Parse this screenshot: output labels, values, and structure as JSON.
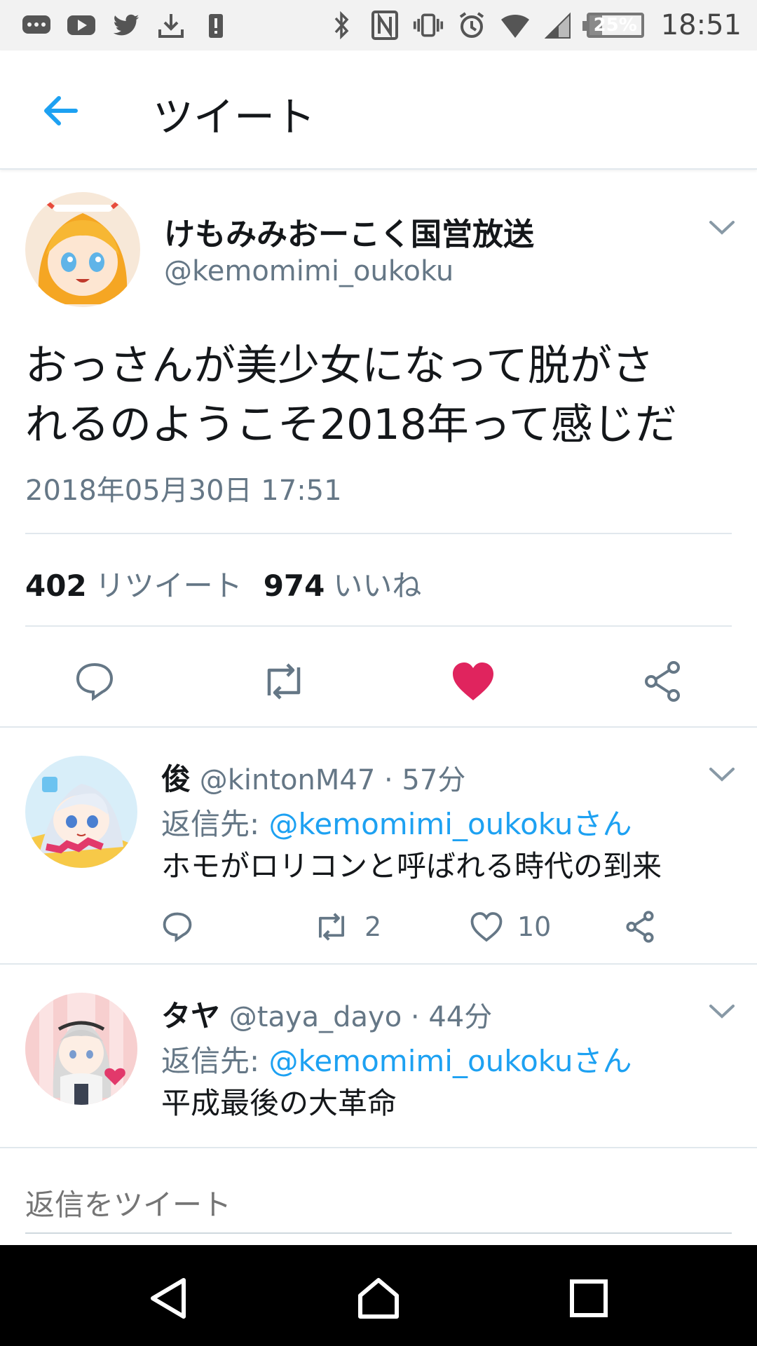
{
  "status_bar": {
    "icons": [
      "messages-icon",
      "youtube-icon",
      "twitter-icon",
      "download-icon",
      "alert-icon",
      "bluetooth-icon",
      "nfc-icon",
      "vibrate-icon",
      "alarm-icon",
      "wifi-icon",
      "signal-icon"
    ],
    "battery": "25%",
    "battery_level": 0.25,
    "time": "18:51"
  },
  "header": {
    "title": "ツイート"
  },
  "tweet": {
    "name": "けもみみおーこく国営放送",
    "handle": "@kemomimi_oukoku",
    "text_line1": "おっさんが美少女になって脱がさ",
    "text_line2": "れるのようこそ2018年って感じだ",
    "timestamp": "2018年05月30日 17:51",
    "retweets_count": "402",
    "retweets_label": "リツイート",
    "likes_count": "974",
    "likes_label": "いいね",
    "liked": true
  },
  "replies": [
    {
      "name": "俊",
      "handle": "@kintonM47",
      "time": "· 57分",
      "reply_to_label": "返信先:",
      "reply_to": "@kemomimi_oukokuさん",
      "text": "ホモがロリコンと呼ばれる時代の到来",
      "retweets": "2",
      "likes": "10"
    },
    {
      "name": "タヤ",
      "handle": "@taya_dayo",
      "time": "· 44分",
      "reply_to_label": "返信先:",
      "reply_to": "@kemomimi_oukokuさん",
      "text": "平成最後の大革命"
    }
  ],
  "compose": {
    "placeholder": "返信をツイート"
  },
  "colors": {
    "accent": "#1da1f2",
    "like": "#e0245e",
    "muted": "#657786",
    "text": "#14171a"
  }
}
